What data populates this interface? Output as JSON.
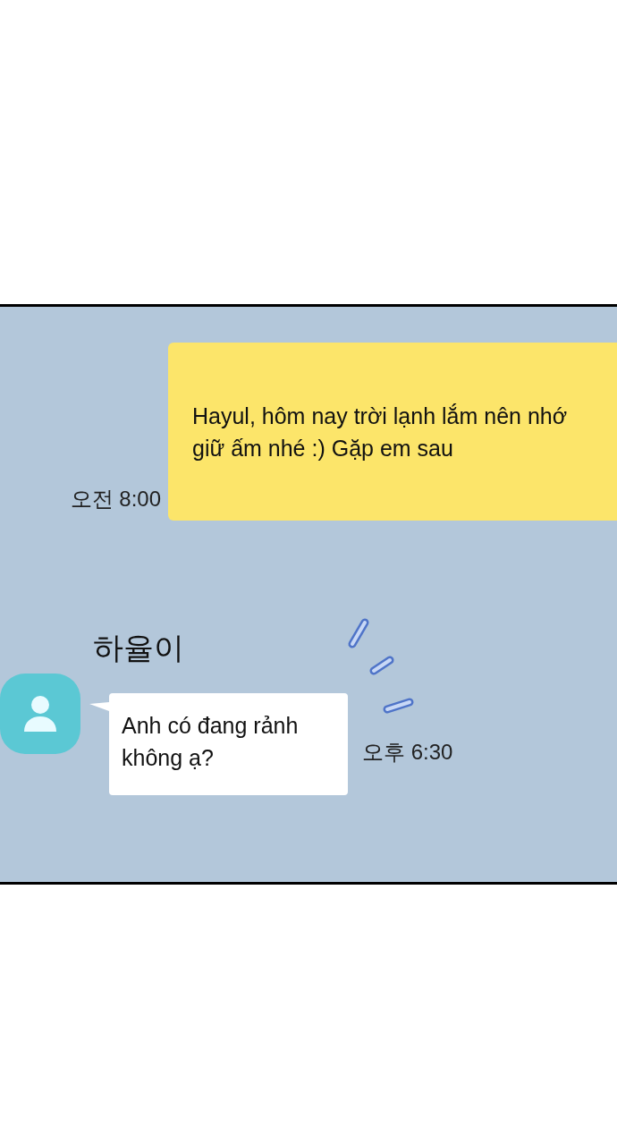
{
  "messages": [
    {
      "kind": "outgoing",
      "text": "Hayul, hôm nay trời lạnh lắm nên nhớ giữ ấm nhé :) Gặp em sau",
      "time": "오전 8:00"
    },
    {
      "kind": "incoming",
      "sender": "하율이",
      "text": "Anh có đang rảnh không ạ?",
      "time": "오후 6:30"
    }
  ]
}
